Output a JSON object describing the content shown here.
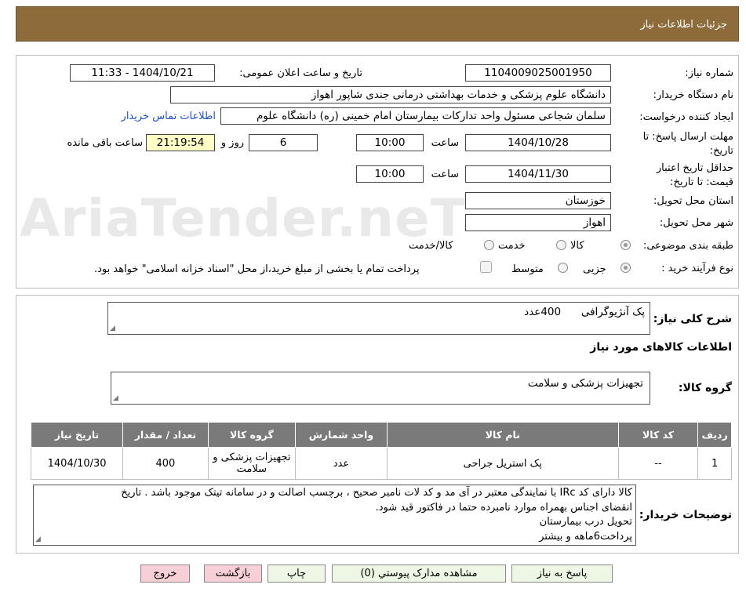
{
  "header": {
    "title": "جزئیات اطلاعات نیاز"
  },
  "watermark": {
    "text": "AriaTender.neT"
  },
  "form": {
    "need_number": {
      "label": "شماره نیاز:",
      "value": "1104009025001950"
    },
    "announce_datetime": {
      "label": "تاریخ و ساعت اعلان عمومی:",
      "value": "1404/10/21 - 11:33"
    },
    "buyer_org": {
      "label": "نام دستگاه خریدار:",
      "value": "دانشگاه علوم پزشکی و خدمات بهداشتی درمانی جندی شاپور اهواز"
    },
    "requester": {
      "label": "ایجاد کننده درخواست:",
      "value": "سلمان شجاعی مسئول واحد تدارکات بیمارستان امام خمینی (ره) دانشگاه علوم",
      "contact_link": "اطلاعات تماس خریدار"
    },
    "deadline": {
      "label": "مهلت ارسال پاسخ: تا تاریخ:",
      "date": "1404/10/28",
      "time_label": "ساعت",
      "time": "10:00",
      "days": "6",
      "days_label": "روز و",
      "remaining": "21:19:54",
      "remaining_label": "ساعت باقی مانده"
    },
    "validity": {
      "label": "حداقل تاریخ اعتبار قیمت: تا تاریخ:",
      "date": "1404/11/30",
      "time_label": "ساعت",
      "time": "10:00"
    },
    "province": {
      "label": "استان محل تحویل:",
      "value": "خوزستان"
    },
    "city": {
      "label": "شهر محل تحویل:",
      "value": "اهواز"
    },
    "category": {
      "label": "طبقه بندی موضوعی:",
      "options": [
        "کالا",
        "خدمت",
        "کالا/خدمت"
      ],
      "selected": "کالا"
    },
    "purchase_type": {
      "label": "نوع فرآیند خرید :",
      "options": [
        "جزیی",
        "متوسط"
      ],
      "note": "پرداخت تمام یا بخشی از مبلغ خرید،از محل \"اسناد خزانه اسلامی\" خواهد بود."
    }
  },
  "description": {
    "label": "شرح کلی نیاز:",
    "value": "پک آنژیوگرافی      400عدد"
  },
  "goods_section": {
    "title": "اطلاعات کالاهای مورد نیاز"
  },
  "goods_group": {
    "label": "گروه کالا:",
    "value": "تجهیزات پزشکی و سلامت"
  },
  "table": {
    "columns": [
      "ردیف",
      "کد کالا",
      "نام کالا",
      "واحد شمارش",
      "گروه کالا",
      "تعداد / مقدار",
      "تاریخ نیاز"
    ],
    "rows": [
      {
        "row": "1",
        "code": "--",
        "name": "پک استریل جراحی",
        "unit": "عدد",
        "group": "تجهیزات پزشکی و سلامت",
        "qty": "400",
        "date": "1404/10/30"
      }
    ]
  },
  "buyer_notes": {
    "label": "توضیحات خریدار:",
    "lines": [
      "کالا دارای کد IRc با نمایندگی معتبر در آی مد و کد لات نامبر صحیح ، برچسب اصالت و در سامانه تیتک موجود باشد . تاریخ",
      "انقضای اجناس بهمراه موارد نامبرده حتما در فاکتور قید شود.",
      "تحویل درب بیمارستان",
      "پرداخت6ماهه و بیشتر"
    ]
  },
  "buttons": {
    "reply": "پاسخ به نیاز",
    "attachments": "مشاهده مدارک پیوستي (0)",
    "print": "چاپ",
    "back": "بازگشت",
    "exit": "خروج"
  },
  "colors": {
    "header_bg": "#8d6b3b",
    "table_header_bg": "#7a7a7a",
    "remaining_bg": "#ffffc6",
    "link": "#1d4ed8",
    "btn_green": "#eef7e3",
    "btn_red": "#f7cfd6"
  }
}
